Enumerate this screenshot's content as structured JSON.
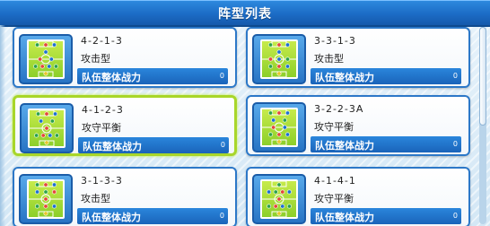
{
  "header": {
    "title": "阵型列表"
  },
  "formations": [
    {
      "name": "4-2-1-3",
      "style": "攻击型",
      "power_label": "队伍整体战力",
      "power_value": "0",
      "selected": false
    },
    {
      "name": "3-3-1-3",
      "style": "攻击型",
      "power_label": "队伍整体战力",
      "power_value": "0",
      "selected": false
    },
    {
      "name": "4-1-2-3",
      "style": "攻守平衡",
      "power_label": "队伍整体战力",
      "power_value": "0",
      "selected": true
    },
    {
      "name": "3-2-2-3A",
      "style": "攻守平衡",
      "power_label": "队伍整体战力",
      "power_value": "0",
      "selected": false
    },
    {
      "name": "3-1-3-3",
      "style": "攻击型",
      "power_label": "队伍整体战力",
      "power_value": "0",
      "selected": false
    },
    {
      "name": "4-1-4-1",
      "style": "攻守平衡",
      "power_label": "队伍整体战力",
      "power_value": "0",
      "selected": false
    }
  ],
  "colors": {
    "accent": "#1c6cc6",
    "selected_border": "#a8d62a",
    "pitch": "#a6dc36"
  },
  "scroll": {
    "position": 0.0,
    "visible_fraction": 0.5
  }
}
